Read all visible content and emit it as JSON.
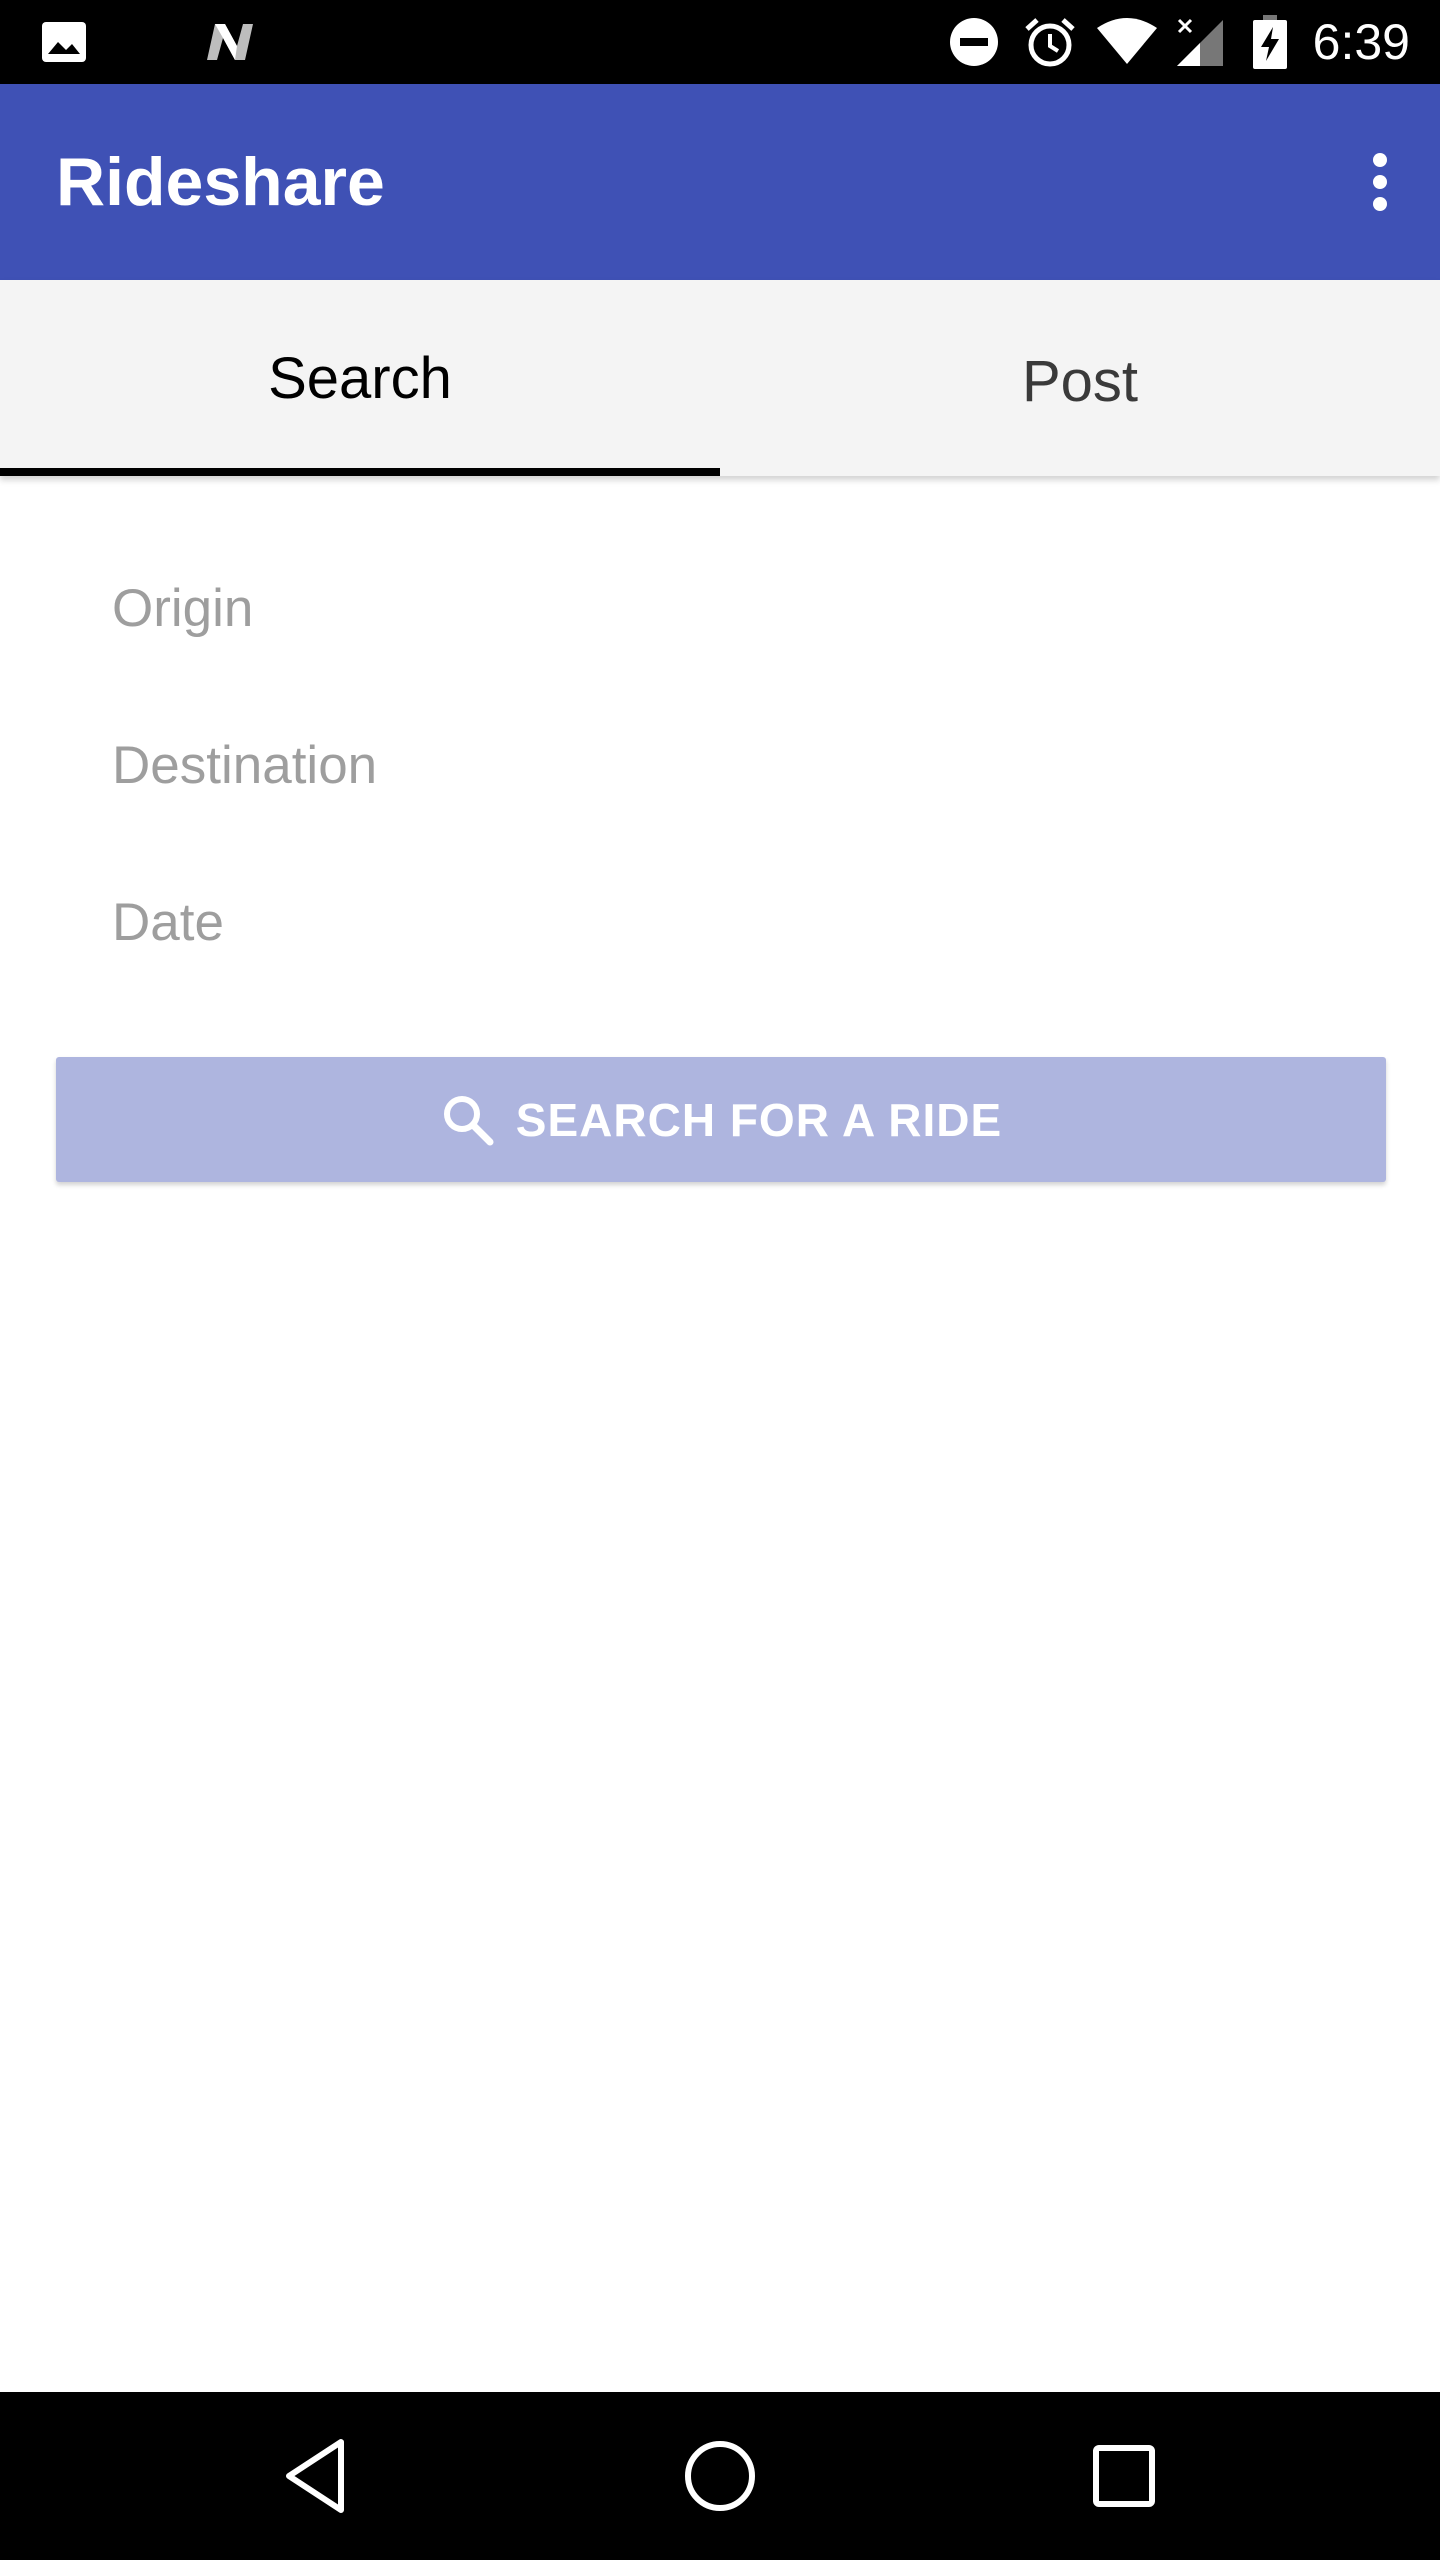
{
  "status_bar": {
    "time": "6:39",
    "icons": [
      "image-icon",
      "n-logo-icon",
      "do-not-disturb-icon",
      "alarm-icon",
      "wifi-icon",
      "signal-icon",
      "battery-charging-icon"
    ]
  },
  "app_bar": {
    "title": "Rideshare",
    "overflow_icon": "more-vert-icon"
  },
  "tabs": [
    {
      "label": "Search",
      "selected": true
    },
    {
      "label": "Post",
      "selected": false
    }
  ],
  "form": {
    "origin": {
      "placeholder": "Origin",
      "value": ""
    },
    "destination": {
      "placeholder": "Destination",
      "value": ""
    },
    "date": {
      "placeholder": "Date",
      "value": ""
    },
    "search_button": {
      "label": "SEARCH FOR A RIDE",
      "icon": "search-icon"
    }
  },
  "nav_bar": {
    "buttons": [
      "back-icon",
      "home-icon",
      "recents-icon"
    ]
  },
  "colors": {
    "primary": "#3f51b5",
    "button_disabled": "#aeb5df",
    "tab_background": "#f4f4f4",
    "hint_text": "#9e9e9e"
  }
}
